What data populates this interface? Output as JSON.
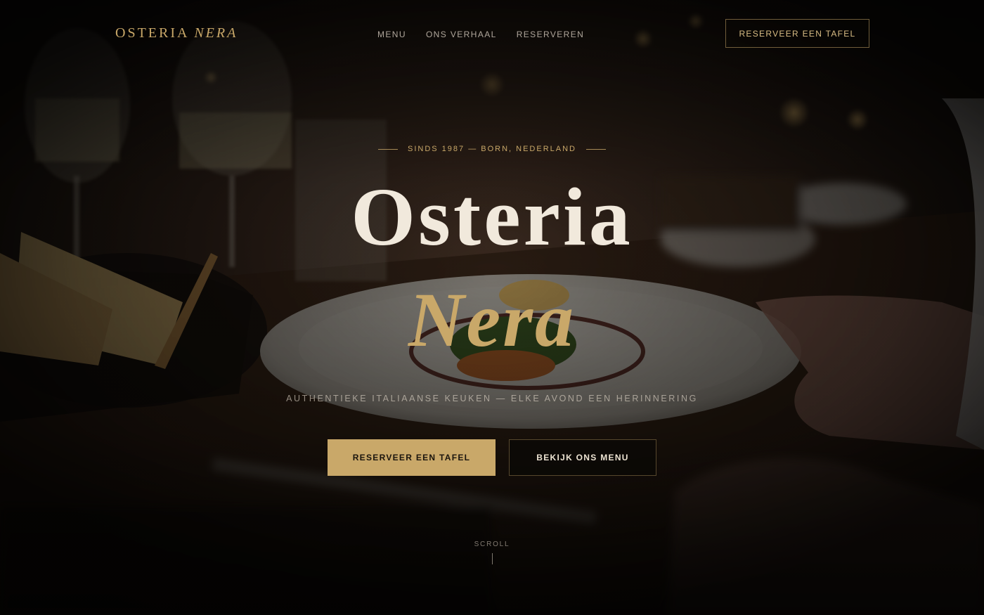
{
  "brand": {
    "name": "OSTERIA",
    "name_italic": "NERA"
  },
  "nav": {
    "links": [
      "MENU",
      "ONS VERHAAL",
      "RESERVEREN"
    ],
    "cta_label": "RESERVEER EEN TAFEL"
  },
  "hero": {
    "eyebrow": "SINDS 1987 — BORN, NEDERLAND",
    "title_line1": "Osteria",
    "title_line2": "Nera",
    "tagline": "AUTHENTIEKE ITALIAANSE KEUKEN — ELKE AVOND EEN HERINNERING",
    "primary_button": "RESERVEER EEN TAFEL",
    "secondary_button": "BEKIJK ONS MENU",
    "scroll_label": "SCROLL"
  },
  "colors": {
    "accent_gold": "#c9a869",
    "cream": "#f1e9dc",
    "dark": "#120e0b"
  }
}
